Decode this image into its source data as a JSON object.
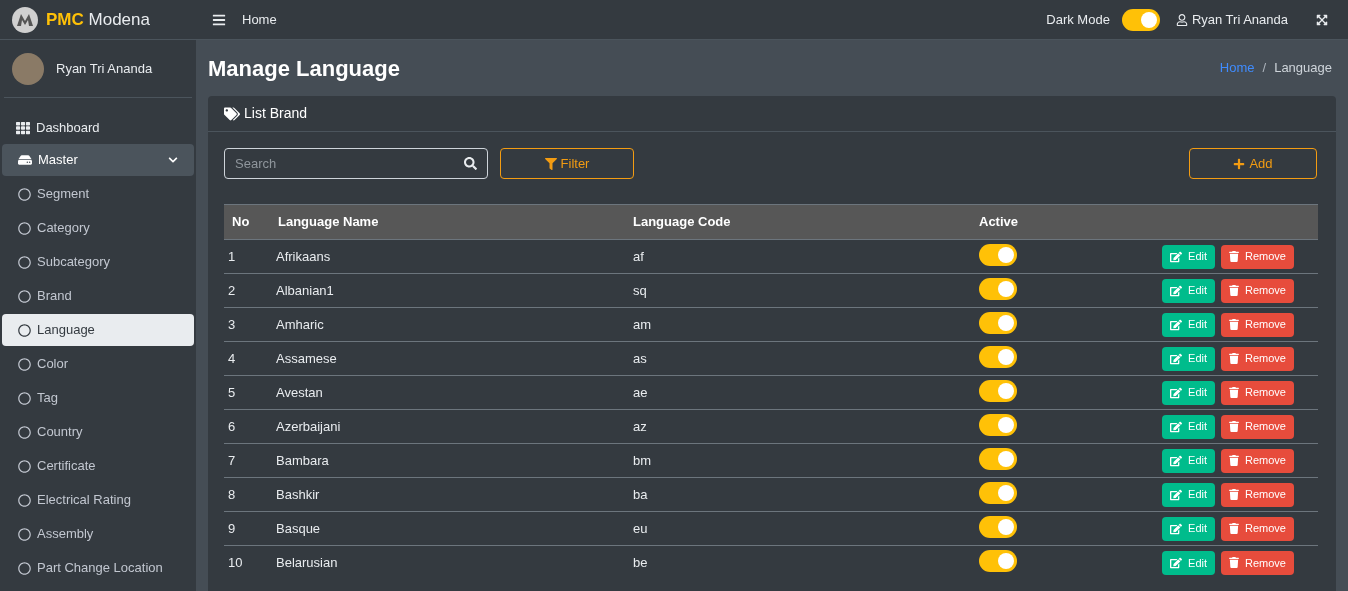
{
  "brand": {
    "prefix": "PMC",
    "name": "Modena"
  },
  "sidebar": {
    "user": "Ryan Tri Ananda",
    "items": [
      {
        "label": "Dashboard",
        "kind": "link"
      },
      {
        "label": "Master",
        "kind": "group",
        "expanded": true,
        "children": [
          {
            "label": "Segment",
            "selected": false
          },
          {
            "label": "Category",
            "selected": false
          },
          {
            "label": "Subcategory",
            "selected": false
          },
          {
            "label": "Brand",
            "selected": false
          },
          {
            "label": "Language",
            "selected": true
          },
          {
            "label": "Color",
            "selected": false
          },
          {
            "label": "Tag",
            "selected": false
          },
          {
            "label": "Country",
            "selected": false
          },
          {
            "label": "Certificate",
            "selected": false
          },
          {
            "label": "Electrical Rating",
            "selected": false
          },
          {
            "label": "Assembly",
            "selected": false
          },
          {
            "label": "Part Change Location",
            "selected": false
          }
        ]
      }
    ]
  },
  "topbar": {
    "home": "Home",
    "dark_mode": {
      "label": "Dark Mode",
      "on": true
    },
    "user": "Ryan Tri Ananda"
  },
  "page": {
    "title": "Manage Language",
    "breadcrumb": [
      "Home",
      "Language"
    ],
    "breadcrumb_separator": "/"
  },
  "card": {
    "title": "List Brand",
    "search": {
      "placeholder": "Search"
    },
    "filter": "Filter",
    "add": "Add",
    "table": {
      "columns": [
        "No",
        "Language Name",
        "Language Code",
        "Active"
      ],
      "rows": [
        {
          "no": "1",
          "name": "Afrikaans",
          "code": "af",
          "active": true,
          "edit": "Edit",
          "remove": "Remove"
        },
        {
          "no": "2",
          "name": "Albanian1",
          "code": "sq",
          "active": true,
          "edit": "Edit",
          "remove": "Remove"
        },
        {
          "no": "3",
          "name": "Amharic",
          "code": "am",
          "active": true,
          "edit": "Edit",
          "remove": "Remove"
        },
        {
          "no": "4",
          "name": "Assamese",
          "code": "as",
          "active": true,
          "edit": "Edit",
          "remove": "Remove"
        },
        {
          "no": "5",
          "name": "Avestan",
          "code": "ae",
          "active": true,
          "edit": "Edit",
          "remove": "Remove"
        },
        {
          "no": "6",
          "name": "Azerbaijani",
          "code": "az",
          "active": true,
          "edit": "Edit",
          "remove": "Remove"
        },
        {
          "no": "7",
          "name": "Bambara",
          "code": "bm",
          "active": true,
          "edit": "Edit",
          "remove": "Remove"
        },
        {
          "no": "8",
          "name": "Bashkir",
          "code": "ba",
          "active": true,
          "edit": "Edit",
          "remove": "Remove"
        },
        {
          "no": "9",
          "name": "Basque",
          "code": "eu",
          "active": true,
          "edit": "Edit",
          "remove": "Remove"
        },
        {
          "no": "10",
          "name": "Belarusian",
          "code": "be",
          "active": true,
          "edit": "Edit",
          "remove": "Remove"
        }
      ]
    }
  }
}
